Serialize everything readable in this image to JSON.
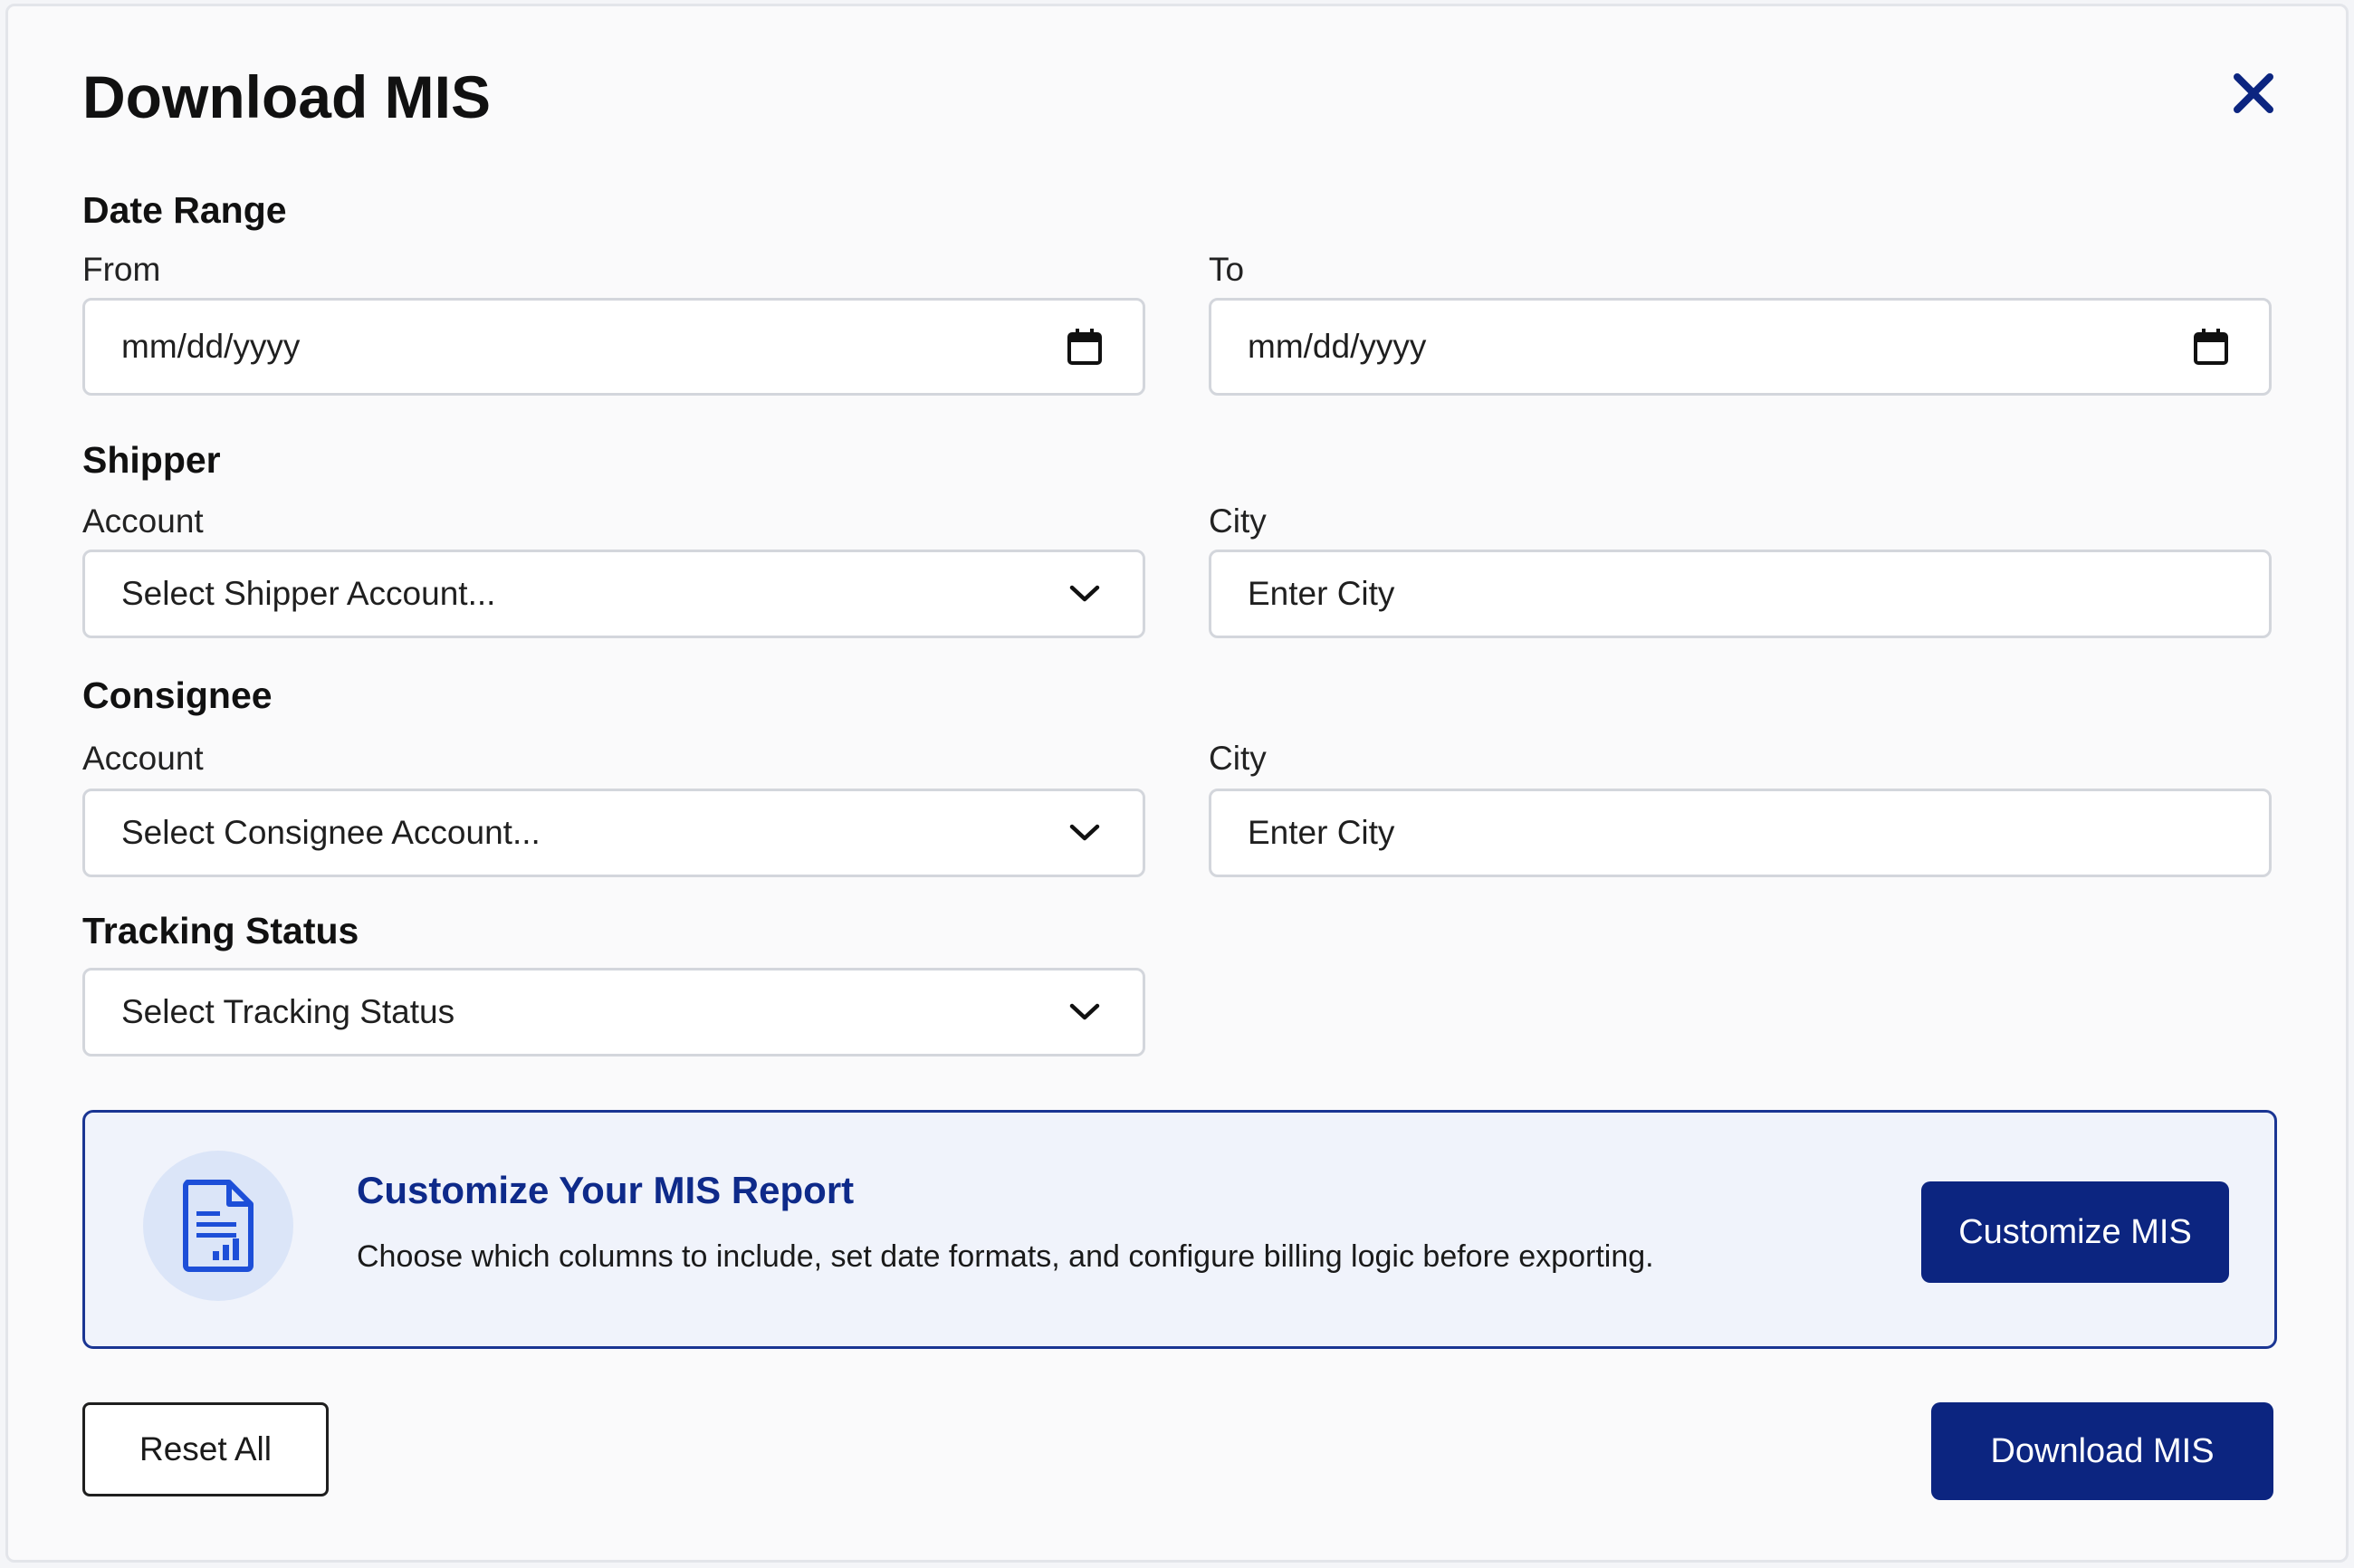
{
  "modal": {
    "title": "Download MIS"
  },
  "date_range": {
    "heading": "Date Range",
    "from_label": "From",
    "from_placeholder": "mm/dd/yyyy",
    "to_label": "To",
    "to_placeholder": "mm/dd/yyyy"
  },
  "shipper": {
    "heading": "Shipper",
    "account_label": "Account",
    "account_placeholder": "Select Shipper Account...",
    "city_label": "City",
    "city_placeholder": "Enter City"
  },
  "consignee": {
    "heading": "Consignee",
    "account_label": "Account",
    "account_placeholder": "Select Consignee Account...",
    "city_label": "City",
    "city_placeholder": "Enter City"
  },
  "tracking": {
    "heading": "Tracking Status",
    "placeholder": "Select Tracking Status"
  },
  "promo": {
    "title": "Customize Your MIS Report",
    "description": "Choose which columns to include, set date formats, and configure billing logic before exporting.",
    "button_label": "Customize MIS",
    "icon": "report-icon"
  },
  "footer": {
    "reset_label": "Reset All",
    "download_label": "Download MIS"
  },
  "colors": {
    "primary": "#0c2580",
    "promo_border": "#1a3593",
    "promo_bg": "#f0f3fb"
  }
}
